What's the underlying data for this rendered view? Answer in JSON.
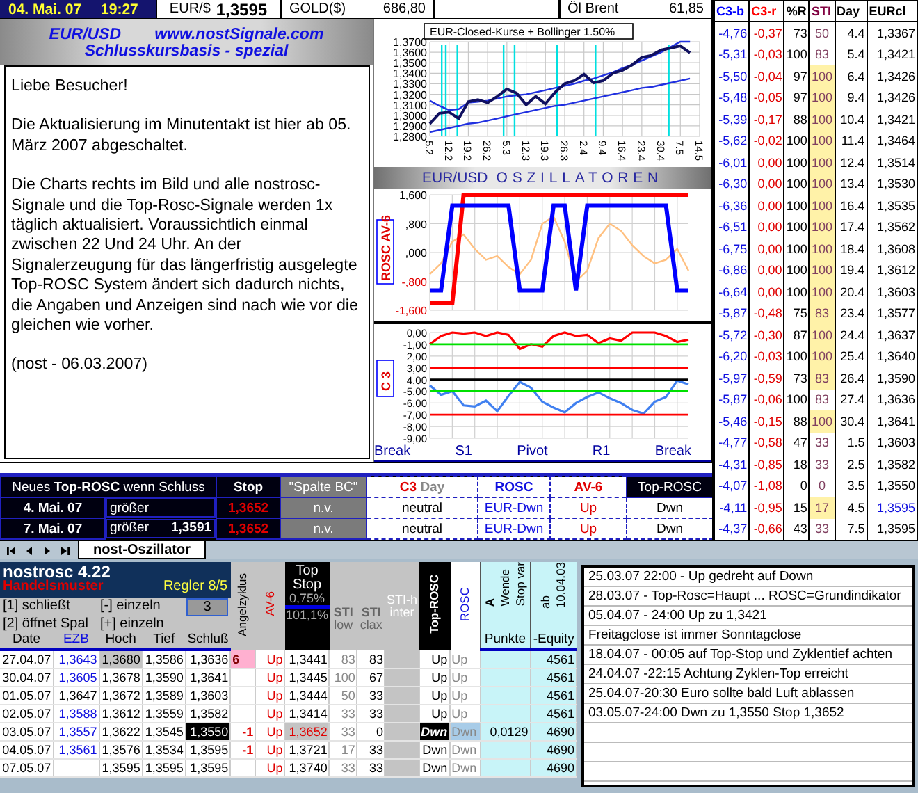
{
  "top_bar": {
    "date": "04. Mai. 07",
    "time": "19:27",
    "eur_label": "EUR/$",
    "eur_value": "1,3595",
    "gold_label": "GOLD($)",
    "gold_value": "686,80",
    "oil_label": "Öl Brent",
    "oil_value": "61,85"
  },
  "header": {
    "pair": "EUR/USD",
    "website": "www.nostSignale.com",
    "subtitle": "Schlusskursbasis - spezial"
  },
  "message": [
    "Liebe Besucher!",
    "Die Aktualisierung im Minutentakt ist hier ab 05. März 2007 abgeschaltet.",
    "Die Charts rechts im Bild und alle nostrosc-Signale und die Top-Rosc-Signale werden 1x täglich aktualisiert. Voraussichtlich einmal zwischen 22 Und 24 Uhr. An der Signalerzeugung für das längerfristig ausgelegte Top-ROSC System ändert sich dadurch nichts, die Angaben und Anzeigen sind nach wie vor die gleichen wie vorher.",
    "(nost - 06.03.2007)"
  ],
  "price_chart": {
    "title": "EUR-Closed-Kurse + Bollinger 1.50%",
    "y_labels": [
      "1,3700",
      "1,3600",
      "1,3500",
      "1,3400",
      "1,3300",
      "1,3200",
      "1,3100",
      "1,3000",
      "1,2900",
      "1,2800"
    ],
    "x_labels": [
      "5.2",
      "12.2",
      "19.2",
      "26.2",
      "5.3",
      "12.3",
      "19.3",
      "26.3",
      "2.4",
      "9.4",
      "16.4",
      "23.4",
      "30.4",
      "7.5",
      "14.5"
    ]
  },
  "oscillator_title": {
    "pair": "EUR/USD",
    "title": "OSZILLATOREN"
  },
  "rosc_chart": {
    "axis_label": "ROSC AV-6",
    "chart_data": {
      "type": "line",
      "grid": true,
      "categories": [
        null,
        null,
        null,
        null,
        null,
        null,
        null,
        null,
        null,
        null,
        null,
        null,
        null,
        null,
        null,
        null,
        null,
        null,
        null,
        null,
        null,
        null,
        null,
        null
      ],
      "ylim": [
        -1600,
        1600
      ],
      "yticks": [
        {
          "value": 1600,
          "label": "1,600"
        },
        {
          "value": 800,
          "label": ",800"
        },
        {
          "value": 0,
          "label": ",000"
        },
        {
          "value": -800,
          "label": "-,800"
        },
        {
          "value": -1600,
          "label": "-1,600"
        }
      ],
      "series": [
        {
          "color": "#ffc080",
          "values": [
            -600,
            -300,
            300,
            500,
            100,
            -200,
            -100,
            -400,
            -600,
            -200,
            800,
            1000,
            300,
            -800,
            -500,
            400,
            800,
            600,
            200,
            -100,
            -300,
            -200,
            100,
            -500
          ]
        },
        {
          "color": "#ff0000",
          "values": [
            -1400,
            -1400,
            -1400,
            1600,
            1600,
            1600,
            1600,
            1600,
            1600,
            1600,
            1600,
            1600,
            1600,
            1600,
            1600,
            1600,
            1600,
            1600,
            1600,
            1600,
            1600,
            1600,
            1600,
            1600
          ]
        },
        {
          "color": "#0000ff",
          "values": [
            -1050,
            -1050,
            1300,
            1300,
            1300,
            1300,
            1300,
            1300,
            -1050,
            -1050,
            -1050,
            1300,
            1300,
            -1050,
            1300,
            1300,
            1300,
            1300,
            1300,
            1300,
            1300,
            1300,
            -1050,
            -1050
          ]
        }
      ]
    }
  },
  "c3_chart": {
    "axis_label": "C 3",
    "unsigned_tick_labels": [
      "2,00",
      "3,00",
      "4,00"
    ],
    "chart_data": {
      "type": "line",
      "grid": true,
      "categories": [
        null,
        null,
        null,
        null,
        null,
        null,
        null,
        null,
        null,
        null,
        null,
        null,
        null,
        null,
        null,
        null,
        null,
        null,
        null,
        null,
        null,
        null,
        null,
        null
      ],
      "ylim": [
        -9,
        0
      ],
      "yticks": [
        {
          "value": 0,
          "label": "0,00"
        },
        {
          "value": -1,
          "label": "-1,00"
        },
        {
          "value": -5,
          "label": "-5,00"
        },
        {
          "value": -6,
          "label": "-6,00"
        },
        {
          "value": -7,
          "label": "-7,00"
        },
        {
          "value": -8,
          "label": "-8,00"
        },
        {
          "value": -9,
          "label": "-9,00"
        }
      ],
      "series": [
        {
          "color": "#ff0000",
          "values": [
            -1,
            -0.3,
            0,
            -0.1,
            0,
            -0.3,
            0,
            -0.2,
            -1.4,
            -1.0,
            -1.2,
            -0.3,
            0,
            -0.3,
            -0.2,
            -0.9,
            -0.5,
            -0.7,
            0,
            0,
            0,
            -0.3,
            -0.8,
            -0.6
          ]
        },
        {
          "color": "#4080f0",
          "values": [
            -4.5,
            -5.3,
            -5,
            -6.2,
            -6.3,
            -5.8,
            -6.7,
            -5.4,
            -4.2,
            -4.7,
            -5.9,
            -6.4,
            -6.8,
            -6.0,
            -5.5,
            -5.1,
            -5.6,
            -6.0,
            -6.6,
            -6.9,
            -5.9,
            -5.5,
            -4.1,
            -4.4
          ]
        }
      ],
      "ref_lines": [
        {
          "axis": "y",
          "value": -1,
          "color": "#00e000"
        },
        {
          "axis": "y",
          "value": -3,
          "color": "#ff0000"
        },
        {
          "axis": "y",
          "value": -4,
          "color": "#000000"
        },
        {
          "axis": "y",
          "value": -5,
          "color": "#00e000"
        },
        {
          "axis": "y",
          "value": -7,
          "color": "#ff0000"
        }
      ]
    }
  },
  "pivot_labels": [
    "Break",
    "S1",
    "Pivot",
    "R1",
    "Break"
  ],
  "summary": {
    "header": {
      "lead": "Neues **Top-ROSC** wenn Schluss",
      "stop": "Stop",
      "column_bc": "\"Spalte BC\"",
      "c3": "C3",
      "day": "Day",
      "rosc": "ROSC",
      "av6": "AV-6",
      "top_rosc": "Top-ROSC"
    },
    "rows": [
      {
        "date": "4. Mai. 07",
        "condition": "größer",
        "stop": "1,3652",
        "bc": "n.v.",
        "c3": "neutral",
        "rosc": "EUR-Dwn",
        "av6": "Up",
        "top_rosc": "Dwn"
      },
      {
        "date": "7. Mai. 07",
        "condition": "größer",
        "value": "1,3591",
        "stop": "1,3652",
        "bc": "n.v.",
        "c3": "neutral",
        "rosc": "EUR-Dwn",
        "av6": "Up",
        "top_rosc": "Dwn"
      }
    ]
  },
  "sheet_tabs": [
    {
      "label": "nost-Oszillator",
      "selected": true
    }
  ],
  "indicator_table": {
    "columns": [
      "C3-b",
      "C3-r",
      "%R",
      "STI",
      "Day",
      "EURcl"
    ],
    "rows": [
      {
        "c3b": "-4,76",
        "c3r": "-0,37",
        "r": "73",
        "sti": "50",
        "day": "4.4",
        "eur": "1,3367",
        "highlight": false,
        "current": false
      },
      {
        "c3b": "-5,31",
        "c3r": "-0,03",
        "r": "100",
        "sti": "83",
        "day": "5.4",
        "eur": "1,3421",
        "highlight": false,
        "current": false
      },
      {
        "c3b": "-5,50",
        "c3r": "-0,04",
        "r": "97",
        "sti": "100",
        "day": "6.4",
        "eur": "1,3426",
        "highlight": true,
        "current": false
      },
      {
        "c3b": "-5,48",
        "c3r": "-0,05",
        "r": "97",
        "sti": "100",
        "day": "9.4",
        "eur": "1,3426",
        "highlight": true,
        "current": false
      },
      {
        "c3b": "-5,39",
        "c3r": "-0,17",
        "r": "88",
        "sti": "100",
        "day": "10.4",
        "eur": "1,3421",
        "highlight": true,
        "current": false
      },
      {
        "c3b": "-5,62",
        "c3r": "-0,02",
        "r": "100",
        "sti": "100",
        "day": "11.4",
        "eur": "1,3464",
        "highlight": true,
        "current": false
      },
      {
        "c3b": "-6,01",
        "c3r": "0,00",
        "r": "100",
        "sti": "100",
        "day": "12.4",
        "eur": "1,3514",
        "highlight": true,
        "current": false
      },
      {
        "c3b": "-6,30",
        "c3r": "0,00",
        "r": "100",
        "sti": "100",
        "day": "13.4",
        "eur": "1,3530",
        "highlight": true,
        "current": false
      },
      {
        "c3b": "-6,36",
        "c3r": "0,00",
        "r": "100",
        "sti": "100",
        "day": "16.4",
        "eur": "1,3535",
        "highlight": true,
        "current": false
      },
      {
        "c3b": "-6,51",
        "c3r": "0,00",
        "r": "100",
        "sti": "100",
        "day": "17.4",
        "eur": "1,3562",
        "highlight": true,
        "current": false
      },
      {
        "c3b": "-6,75",
        "c3r": "0,00",
        "r": "100",
        "sti": "100",
        "day": "18.4",
        "eur": "1,3608",
        "highlight": true,
        "current": false
      },
      {
        "c3b": "-6,86",
        "c3r": "0,00",
        "r": "100",
        "sti": "100",
        "day": "19.4",
        "eur": "1,3612",
        "highlight": true,
        "current": false
      },
      {
        "c3b": "-6,64",
        "c3r": "0,00",
        "r": "100",
        "sti": "100",
        "day": "20.4",
        "eur": "1,3603",
        "highlight": true,
        "current": false
      },
      {
        "c3b": "-5,87",
        "c3r": "-0,48",
        "r": "75",
        "sti": "83",
        "day": "23.4",
        "eur": "1,3577",
        "highlight": true,
        "current": false
      },
      {
        "c3b": "-5,72",
        "c3r": "-0,30",
        "r": "87",
        "sti": "100",
        "day": "24.4",
        "eur": "1,3637",
        "highlight": true,
        "current": false
      },
      {
        "c3b": "-6,20",
        "c3r": "-0,03",
        "r": "100",
        "sti": "100",
        "day": "25.4",
        "eur": "1,3640",
        "highlight": true,
        "current": false
      },
      {
        "c3b": "-5,97",
        "c3r": "-0,59",
        "r": "73",
        "sti": "83",
        "day": "26.4",
        "eur": "1,3590",
        "highlight": true,
        "current": false
      },
      {
        "c3b": "-5,87",
        "c3r": "-0,06",
        "r": "100",
        "sti": "83",
        "day": "27.4",
        "eur": "1,3636",
        "highlight": false,
        "current": false
      },
      {
        "c3b": "-5,46",
        "c3r": "-0,15",
        "r": "88",
        "sti": "100",
        "day": "30.4",
        "eur": "1,3641",
        "highlight": true,
        "current": false
      },
      {
        "c3b": "-4,77",
        "c3r": "-0,58",
        "r": "47",
        "sti": "33",
        "day": "1.5",
        "eur": "1,3603",
        "highlight": false,
        "current": false
      },
      {
        "c3b": "-4,31",
        "c3r": "-0,85",
        "r": "18",
        "sti": "33",
        "day": "2.5",
        "eur": "1,3582",
        "highlight": false,
        "current": false
      },
      {
        "c3b": "-4,07",
        "c3r": "-1,08",
        "r": "0",
        "sti": "0",
        "day": "3.5",
        "eur": "1,3550",
        "highlight": false,
        "current": false
      },
      {
        "c3b": "-4,11",
        "c3r": "-0,95",
        "r": "15",
        "sti": "17",
        "day": "4.5",
        "eur": "1,3595",
        "highlight": true,
        "current": true
      },
      {
        "c3b": "-4,37",
        "c3r": "-0,66",
        "r": "43",
        "sti": "33",
        "day": "7.5",
        "eur": "1,3595",
        "highlight": false,
        "current": false
      }
    ]
  },
  "trade_panel": {
    "title": "nostrosc 4.22",
    "pattern": "Handelsmuster",
    "regulator": "Regler 8/5",
    "options": [
      "[1] schließt",
      "[-] einzeln",
      "[2] öffnet Spal",
      "[+] einzeln"
    ],
    "field_value": "3",
    "columns": {
      "date": "Date",
      "ezb": "EZB",
      "high": "Hoch",
      "low": "Tief",
      "close": "Schluß",
      "cycle": "Angelzyklus",
      "av6": "AV-6",
      "stop_top": "Top",
      "stop_bottom": "Stop",
      "stop_pct1": "0,75%",
      "stop_pct2": "101,1%",
      "sti_low": "STI",
      "sti_low_sub": "low",
      "sti_clax": "STI",
      "sti_clax_sub": "clax",
      "sti_h": "STI-h",
      "sti_h_sub": "inter",
      "top_rosc": "Top-ROSC",
      "rosc": "ROSC",
      "wende_a": "A",
      "wende": "Wende",
      "wende_sub": "Stop var",
      "points": "Punkte",
      "since": "ab",
      "since_date": "10.04.03",
      "equity": "-Equity"
    },
    "rows": [
      {
        "date": "27.04.07",
        "ezb": "1,3643",
        "ezb_marked": true,
        "high": "1,3680",
        "high_marked": true,
        "low": "1,3586",
        "close": "1,3636",
        "close_marked": false,
        "cycle": {
          "text": "6",
          "kind": "peak"
        },
        "av6": "Up",
        "stop": "1,3441",
        "stop_marked": false,
        "sti_low": "83",
        "sti_clax": "83",
        "top_rosc": "Up",
        "top_rosc_marked": false,
        "rosc": "Up",
        "rosc_marked": false,
        "equity": "4561"
      },
      {
        "date": "30.04.07",
        "ezb": "1,3605",
        "ezb_marked": true,
        "high": "1,3678",
        "high_marked": false,
        "low": "1,3590",
        "close": "1,3641",
        "close_marked": false,
        "av6": "Up",
        "stop": "1,3445",
        "stop_marked": false,
        "sti_low": "100",
        "sti_clax": "67",
        "top_rosc": "Up",
        "top_rosc_marked": false,
        "rosc": "Up",
        "rosc_marked": false,
        "equity": "4561"
      },
      {
        "date": "01.05.07",
        "ezb": "1,3647",
        "ezb_marked": false,
        "high": "1,3672",
        "high_marked": false,
        "low": "1,3589",
        "close": "1,3603",
        "close_marked": false,
        "av6": "Up",
        "stop": "1,3444",
        "stop_marked": false,
        "sti_low": "50",
        "sti_clax": "33",
        "top_rosc": "Up",
        "top_rosc_marked": false,
        "rosc": "Up",
        "rosc_marked": false,
        "equity": "4561"
      },
      {
        "date": "02.05.07",
        "ezb": "1,3588",
        "ezb_marked": true,
        "high": "1,3612",
        "high_marked": false,
        "low": "1,3559",
        "close": "1,3582",
        "close_marked": false,
        "av6": "Up",
        "stop": "1,3414",
        "stop_marked": false,
        "sti_low": "33",
        "sti_clax": "33",
        "top_rosc": "Up",
        "top_rosc_marked": false,
        "rosc": "Up",
        "rosc_marked": false,
        "equity": "4561"
      },
      {
        "date": "03.05.07",
        "ezb": "1,3557",
        "ezb_marked": true,
        "high": "1,3622",
        "high_marked": false,
        "low": "1,3545",
        "close": "1,3550",
        "close_marked": true,
        "cycle": {
          "text": "-1",
          "kind": "turn"
        },
        "av6": "Up",
        "stop": "1,3652",
        "stop_marked": true,
        "sti_low": "33",
        "sti_clax": "0",
        "top_rosc": "Dwn",
        "top_rosc_marked": true,
        "rosc": "Dwn",
        "rosc_marked": true,
        "points": "0,0129",
        "equity": "4690"
      },
      {
        "date": "04.05.07",
        "ezb": "1,3561",
        "ezb_marked": true,
        "high": "1,3576",
        "high_marked": false,
        "low": "1,3534",
        "close": "1,3595",
        "close_marked": false,
        "cycle": {
          "text": "-1",
          "kind": "turn"
        },
        "av6": "Up",
        "stop": "1,3721",
        "stop_marked": false,
        "sti_low": "17",
        "sti_clax": "33",
        "top_rosc": "Dwn",
        "top_rosc_marked": false,
        "rosc": "Dwn",
        "rosc_marked": false,
        "equity": "4690"
      },
      {
        "date": "07.05.07",
        "high": "1,3595",
        "high_marked": false,
        "low": "1,3595",
        "close": "1,3595",
        "close_marked": false,
        "av6": "Up",
        "stop": "1,3740",
        "stop_marked": false,
        "sti_low": "33",
        "sti_clax": "33",
        "top_rosc": "Dwn",
        "top_rosc_marked": false,
        "rosc": "Dwn",
        "rosc_marked": false,
        "equity": "4690"
      }
    ]
  },
  "notes": [
    "25.03.07 22:00 - Up gedreht auf Down",
    "28.03.07 - Top-Rosc=Haupt ... ROSC=Grundindikator",
    "05.04.07 - 24:00 Up zu 1,3421",
    "Freitagclose ist immer Sonntagclose",
    "18.04.07 - 00:05 auf Top-Stop und Zyklentief achten",
    "24.04.07 -22:15 Achtung Zyklen-Top erreicht",
    "25.04.07-20:30 Euro sollte bald Luft ablassen",
    "03.05.07-24:00 Dwn zu 1,3550 Stop 1,3652"
  ]
}
